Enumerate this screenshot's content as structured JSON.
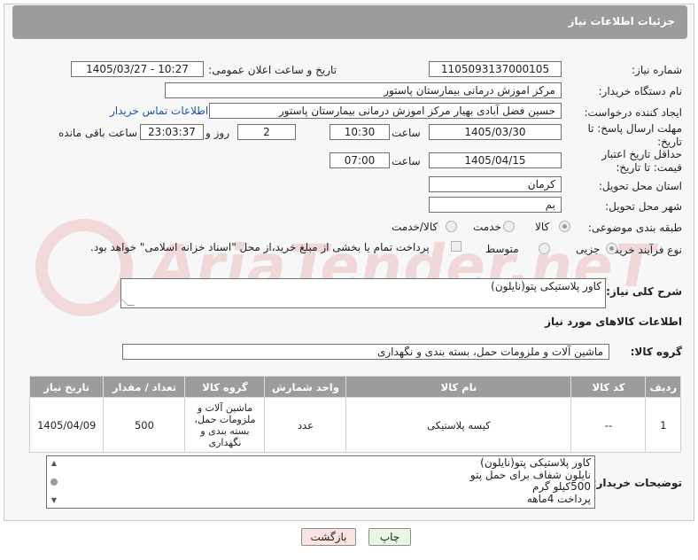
{
  "header": {
    "title": "جزئیات اطلاعات نیاز"
  },
  "fields": {
    "need_number_label": "شماره نیاز:",
    "need_number": "1105093137000105",
    "announce_label": "تاریخ و ساعت اعلان عمومی:",
    "announce_value": "1405/03/27 - 10:27",
    "buyer_org_label": "نام دستگاه خریدار:",
    "buyer_org": "مرکز اموزش درمانی بیمارستان پاستور",
    "creator_label": "ایجاد کننده درخواست:",
    "creator": "حسین فضل آبادی بهیار مرکز اموزش درمانی بیمارستان پاستور",
    "contact_link": "اطلاعات تماس خریدار",
    "deadline_label": "مهلت ارسال پاسخ: تا تاریخ:",
    "deadline_date": "1405/03/30",
    "time_label": "ساعت",
    "deadline_time": "10:30",
    "days_value": "2",
    "days_label": "روز و",
    "remaining_time": "23:03:37",
    "remaining_label": "ساعت باقی مانده",
    "validity_label": "حداقل تاریخ اعتبار قیمت: تا تاریخ:",
    "validity_date": "1405/04/15",
    "validity_time": "07:00",
    "province_label": "استان محل تحویل:",
    "province": "کرمان",
    "city_label": "شهر محل تحویل:",
    "city": "بم",
    "category_label": "طبقه بندی موضوعی:",
    "category_options": [
      "کالا",
      "خدمت",
      "کالا/خدمت"
    ],
    "process_label": "نوع فرآیند خرید :",
    "process_options": [
      "جزیی",
      "متوسط"
    ],
    "payment_note": "پرداخت تمام یا بخشی از مبلغ خرید،از محل \"اسناد خزانه اسلامی\" خواهد بود."
  },
  "summary": {
    "label": "شرح کلی نیاز:",
    "value": "کاور پلاستیکی پتو(نایلون)"
  },
  "goods_section": {
    "title": "اطلاعات کالاهای مورد نیاز",
    "group_label": "گروه کالا:",
    "group_value": "ماشین آلات و ملزومات حمل، بسته بندی و نگهداری"
  },
  "table": {
    "headers": [
      "ردیف",
      "کد کالا",
      "نام کالا",
      "واحد شمارش",
      "گروه کالا",
      "تعداد / مقدار",
      "تاریخ نیاز"
    ],
    "rows": [
      {
        "row": "1",
        "code": "--",
        "name": "کیسه پلاستیکی",
        "unit": "عدد",
        "group": "ماشین آلات و ملزومات حمل، بسته بندی و نگهداری",
        "qty": "500",
        "date": "1405/04/09"
      }
    ]
  },
  "buyer_notes": {
    "label": "توضیحات خریدار:",
    "lines": [
      "کاور پلاستیکی پتو(نایلون)",
      "نایلون شفاف برای حمل پتو",
      "500کیلو گرم",
      "پرداخت 4ماهه"
    ]
  },
  "buttons": {
    "print": "چاپ",
    "back": "بازگشت"
  },
  "colors": {
    "header_bg": "#9c9c9c",
    "link": "#1a55a8",
    "print_bg": "#e9f6e5",
    "back_bg": "#fbe3e3"
  }
}
